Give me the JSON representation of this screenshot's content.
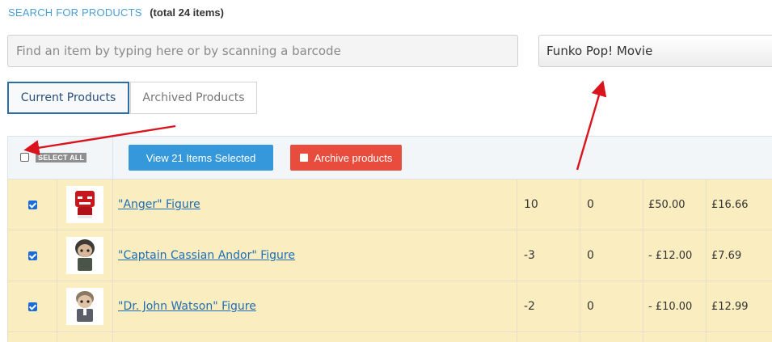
{
  "header": {
    "title": "SEARCH FOR PRODUCTS",
    "total": "(total 24 items)"
  },
  "search": {
    "placeholder": "Find an item by typing here or by scanning a barcode",
    "value": ""
  },
  "category": {
    "selected": "Funko Pop! Movie"
  },
  "tabs": [
    {
      "label": "Current Products",
      "active": true
    },
    {
      "label": "Archived Products",
      "active": false
    }
  ],
  "toolbar": {
    "select_all_label": "SELECT ALL",
    "view_selected_label": "View 21 Items Selected",
    "archive_label": "Archive products"
  },
  "rows": [
    {
      "name": "\"Anger\" Figure",
      "qty": "10",
      "col2": "0",
      "price1": "£50.00",
      "price2": "£16.66",
      "checked": true,
      "thumb": "red-figure-icon"
    },
    {
      "name": "\"Captain Cassian Andor\" Figure",
      "qty": "-3",
      "col2": "0",
      "price1": "- £12.00",
      "price2": "£7.69",
      "checked": true,
      "thumb": "dark-figure-icon"
    },
    {
      "name": "\"Dr. John Watson\" Figure",
      "qty": "-2",
      "col2": "0",
      "price1": "- £10.00",
      "price2": "£12.99",
      "checked": true,
      "thumb": "suit-figure-icon"
    }
  ],
  "colors": {
    "accent_blue": "#3498db",
    "archive_red": "#e74c3c",
    "row_highlight": "#faedc0",
    "annotation_arrow": "#d9141c"
  }
}
